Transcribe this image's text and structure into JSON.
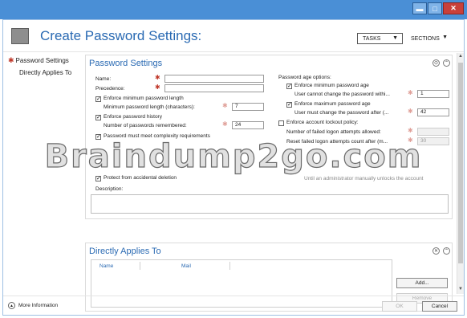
{
  "window": {
    "minimize_glyph": "▬",
    "maximize_glyph": "□",
    "close_glyph": "✕"
  },
  "header": {
    "title": "Create Password Settings:",
    "tasks_label": "TASKS",
    "sections_label": "SECTIONS"
  },
  "nav": {
    "items": [
      {
        "label": "Password Settings",
        "required": true
      },
      {
        "label": "Directly Applies To",
        "required": false
      }
    ]
  },
  "password_settings": {
    "heading": "Password Settings",
    "name_label": "Name:",
    "name_value": "",
    "precedence_label": "Precedence:",
    "precedence_value": "",
    "enforce_min_length_label": "Enforce minimum password length",
    "enforce_min_length_checked": true,
    "min_length_label": "Minimum password length (characters):",
    "min_length_value": "7",
    "enforce_history_label": "Enforce password history",
    "enforce_history_checked": true,
    "history_label": "Number of passwords remembered:",
    "history_value": "24",
    "complexity_label": "Password must meet complexity requirements",
    "complexity_checked": true,
    "protect_label": "Protect from accidental deletion",
    "protect_checked": true,
    "description_label": "Description:",
    "description_value": "",
    "age_heading": "Password age options:",
    "enforce_min_age_label": "Enforce minimum password age",
    "enforce_min_age_checked": true,
    "min_age_label": "User cannot change the password withi...",
    "min_age_value": "1",
    "enforce_max_age_label": "Enforce maximum password age",
    "enforce_max_age_checked": true,
    "max_age_label": "User must change the password after (...",
    "max_age_value": "42",
    "lockout_label": "Enforce account lockout policy:",
    "lockout_checked": false,
    "failed_attempts_label": "Number of failed logon attempts allowed:",
    "failed_attempts_value": "",
    "reset_count_label": "Reset failed logon attempts count after (m...",
    "reset_count_value": "30",
    "unlock_manual_label": "Until an administrator manually unlocks the account"
  },
  "directly_applies_to": {
    "heading": "Directly Applies To",
    "columns": [
      "Name",
      "Mail"
    ],
    "add_label": "Add...",
    "remove_label": "Remove"
  },
  "footer": {
    "more_info_label": "More Information",
    "ok_label": "OK",
    "cancel_label": "Cancel"
  },
  "watermark": {
    "text": "Braindump2go.com"
  }
}
